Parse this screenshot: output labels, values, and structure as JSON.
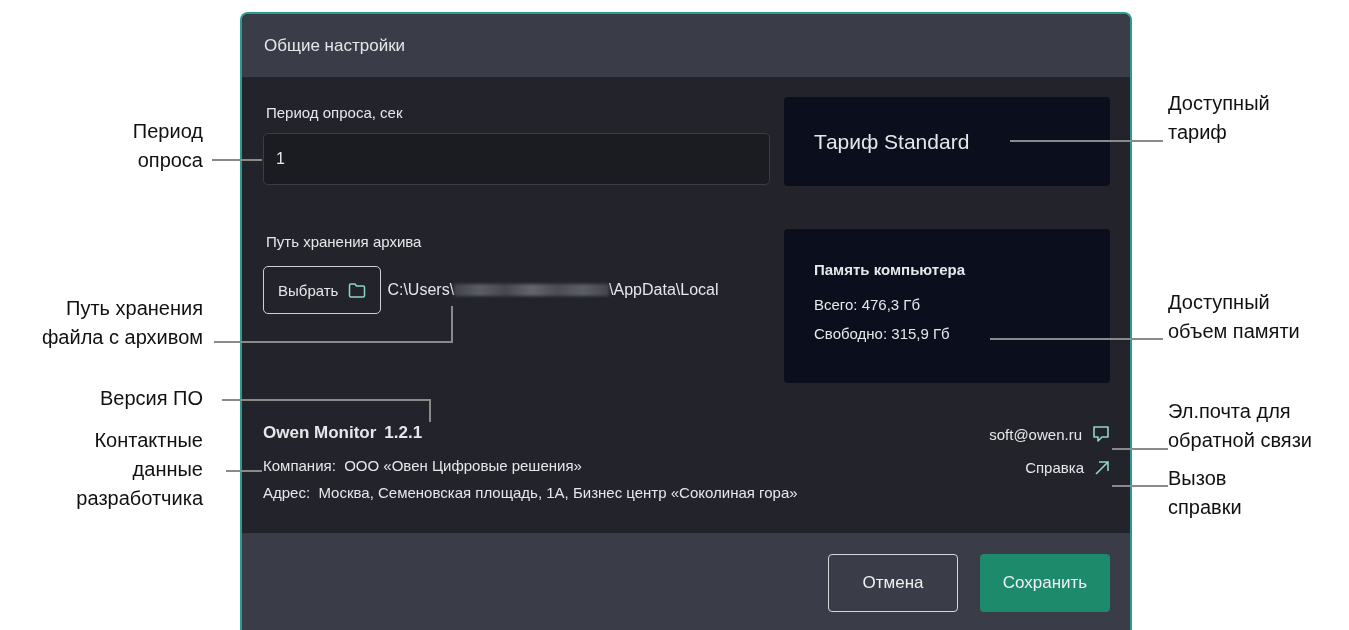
{
  "dialog": {
    "title": "Общие настройки"
  },
  "poll_period": {
    "label": "Период опроса, сек",
    "value": "1"
  },
  "archive_path": {
    "label": "Путь хранения архива",
    "button": "Выбрать",
    "path_start": "C:\\Users\\",
    "path_end": "\\AppData\\Local",
    "redacted": true
  },
  "tariff": {
    "text": "Тариф Standard"
  },
  "memory": {
    "title": "Память компьютера",
    "total": "Всего: 476,3 Гб",
    "free": "Свободно: 315,9 Гб"
  },
  "about": {
    "product": "Owen Monitor",
    "version": "1.2.1",
    "company": "Компания:  ООО «Овен Цифровые решения»",
    "address": "Адрес:  Москва, Семеновская площадь, 1А, Бизнес центр «Соколиная гора»"
  },
  "links": [
    {
      "kind": "email",
      "label": "soft@owen.ru"
    },
    {
      "kind": "help",
      "label": "Справка"
    }
  ],
  "buttons": [
    {
      "kind": "secondary",
      "label": "Отмена"
    },
    {
      "kind": "primary",
      "label": "Сохранить"
    }
  ],
  "annotations": [
    {
      "kind": "left",
      "lines": [
        "Период",
        "опроса"
      ]
    },
    {
      "kind": "left",
      "lines": [
        "Путь хранения",
        "файла с архивом"
      ]
    },
    {
      "kind": "left",
      "lines": [
        "Версия ПО"
      ]
    },
    {
      "kind": "left",
      "lines": [
        "Контактные",
        "данные",
        "разработчика"
      ]
    },
    {
      "kind": "right",
      "lines": [
        "Доступный",
        "тариф"
      ]
    },
    {
      "kind": "right",
      "lines": [
        "Доступный",
        "объем памяти"
      ]
    },
    {
      "kind": "right",
      "lines": [
        "Эл.почта для",
        "обратной связи"
      ]
    },
    {
      "kind": "right",
      "lines": [
        "Вызов",
        "справки"
      ]
    }
  ]
}
